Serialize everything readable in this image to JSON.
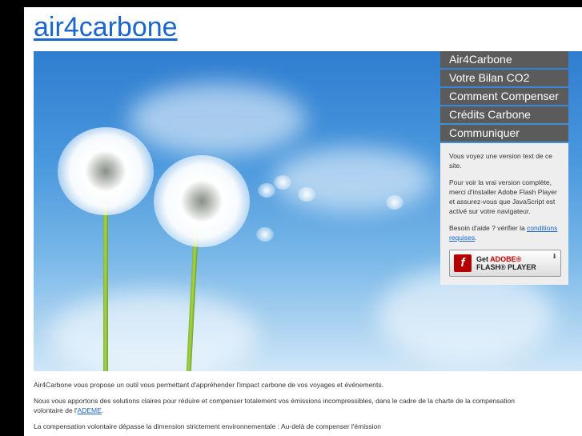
{
  "site": {
    "title": "air4carbone"
  },
  "nav": {
    "items": [
      {
        "label": "Air4Carbone"
      },
      {
        "label": "Votre Bilan CO2"
      },
      {
        "label": "Comment Compenser"
      },
      {
        "label": "Crédits Carbone"
      },
      {
        "label": "Communiquer"
      }
    ]
  },
  "flash_notice": {
    "p1": "Vous voyez une version text de ce site.",
    "p2": "Pour voir la vrai version complète, merci d'installer Adobe Flash Player et assurez-vous que JavaScript est activé sur votre navigateur.",
    "p3_prefix": "Besoin d'aide ? vérifier la ",
    "p3_link": "conditions requises",
    "p3_suffix": ".",
    "button": {
      "line1_prefix": "Get ",
      "line1_brand": "ADOBE®",
      "line2": "FLASH® PLAYER"
    }
  },
  "content": {
    "p1": "Air4Carbone vous propose un outil vous permettant d'appréhender l'impact carbone de vos voyages et événements.",
    "p2_prefix": "Nous vous apportons des solutions claires pour réduire et compenser totalement vos émissions incompressibles, dans le cadre de la charte de la compensation volontaire de l'",
    "p2_link": "ADEME",
    "p2_suffix": ".",
    "p3": "La compensation volontaire dépasse la dimension strictement environnementale : Au-delà de compenser l'émission"
  }
}
